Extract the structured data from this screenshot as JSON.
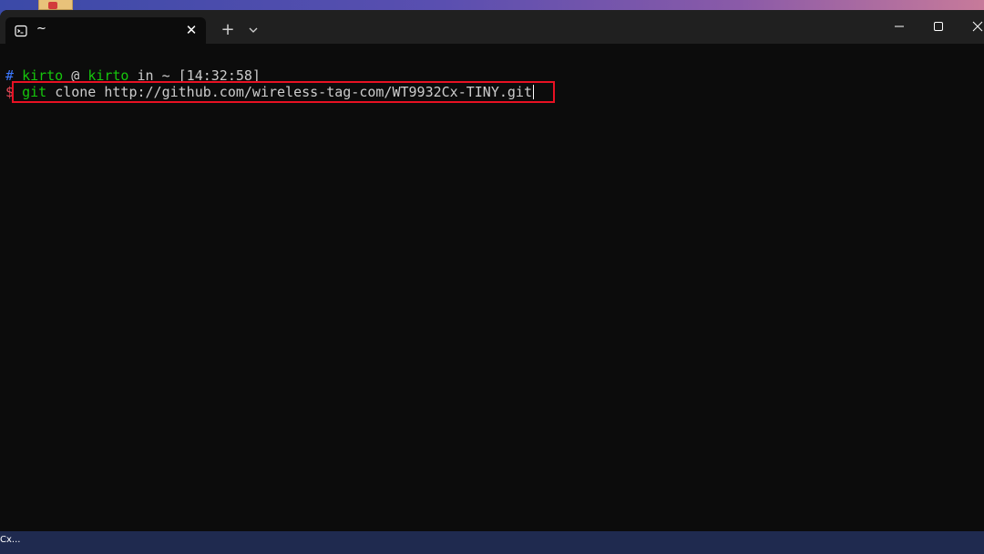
{
  "tab": {
    "title": "~",
    "close_glyph": "✕",
    "icon": "terminal-icon"
  },
  "titlebar": {
    "new_tab_glyph": "+",
    "dropdown_icon": "chevron-down-icon",
    "minimize_icon": "minimize-icon",
    "maximize_icon": "maximize-icon",
    "close_icon": "close-icon"
  },
  "terminal": {
    "prompt": {
      "hash": "#",
      "user": "kirto",
      "at": "@",
      "host": "kirto",
      "in_word": "in",
      "dir": "~",
      "time": "[14:32:58]"
    },
    "command": {
      "dollar": "$",
      "program": "git",
      "args": "clone http://github.com/wireless-tag-com/WT9932Cx-TINY.git"
    }
  },
  "taskbar": {
    "label": "Cx..."
  },
  "colors": {
    "terminal_bg": "#0c0c0c",
    "titlebar_bg": "#202020",
    "prompt_hash": "#3b78ff",
    "prompt_user": "#16c60c",
    "prompt_dollar": "#e74856",
    "highlight_border": "#e81123"
  }
}
